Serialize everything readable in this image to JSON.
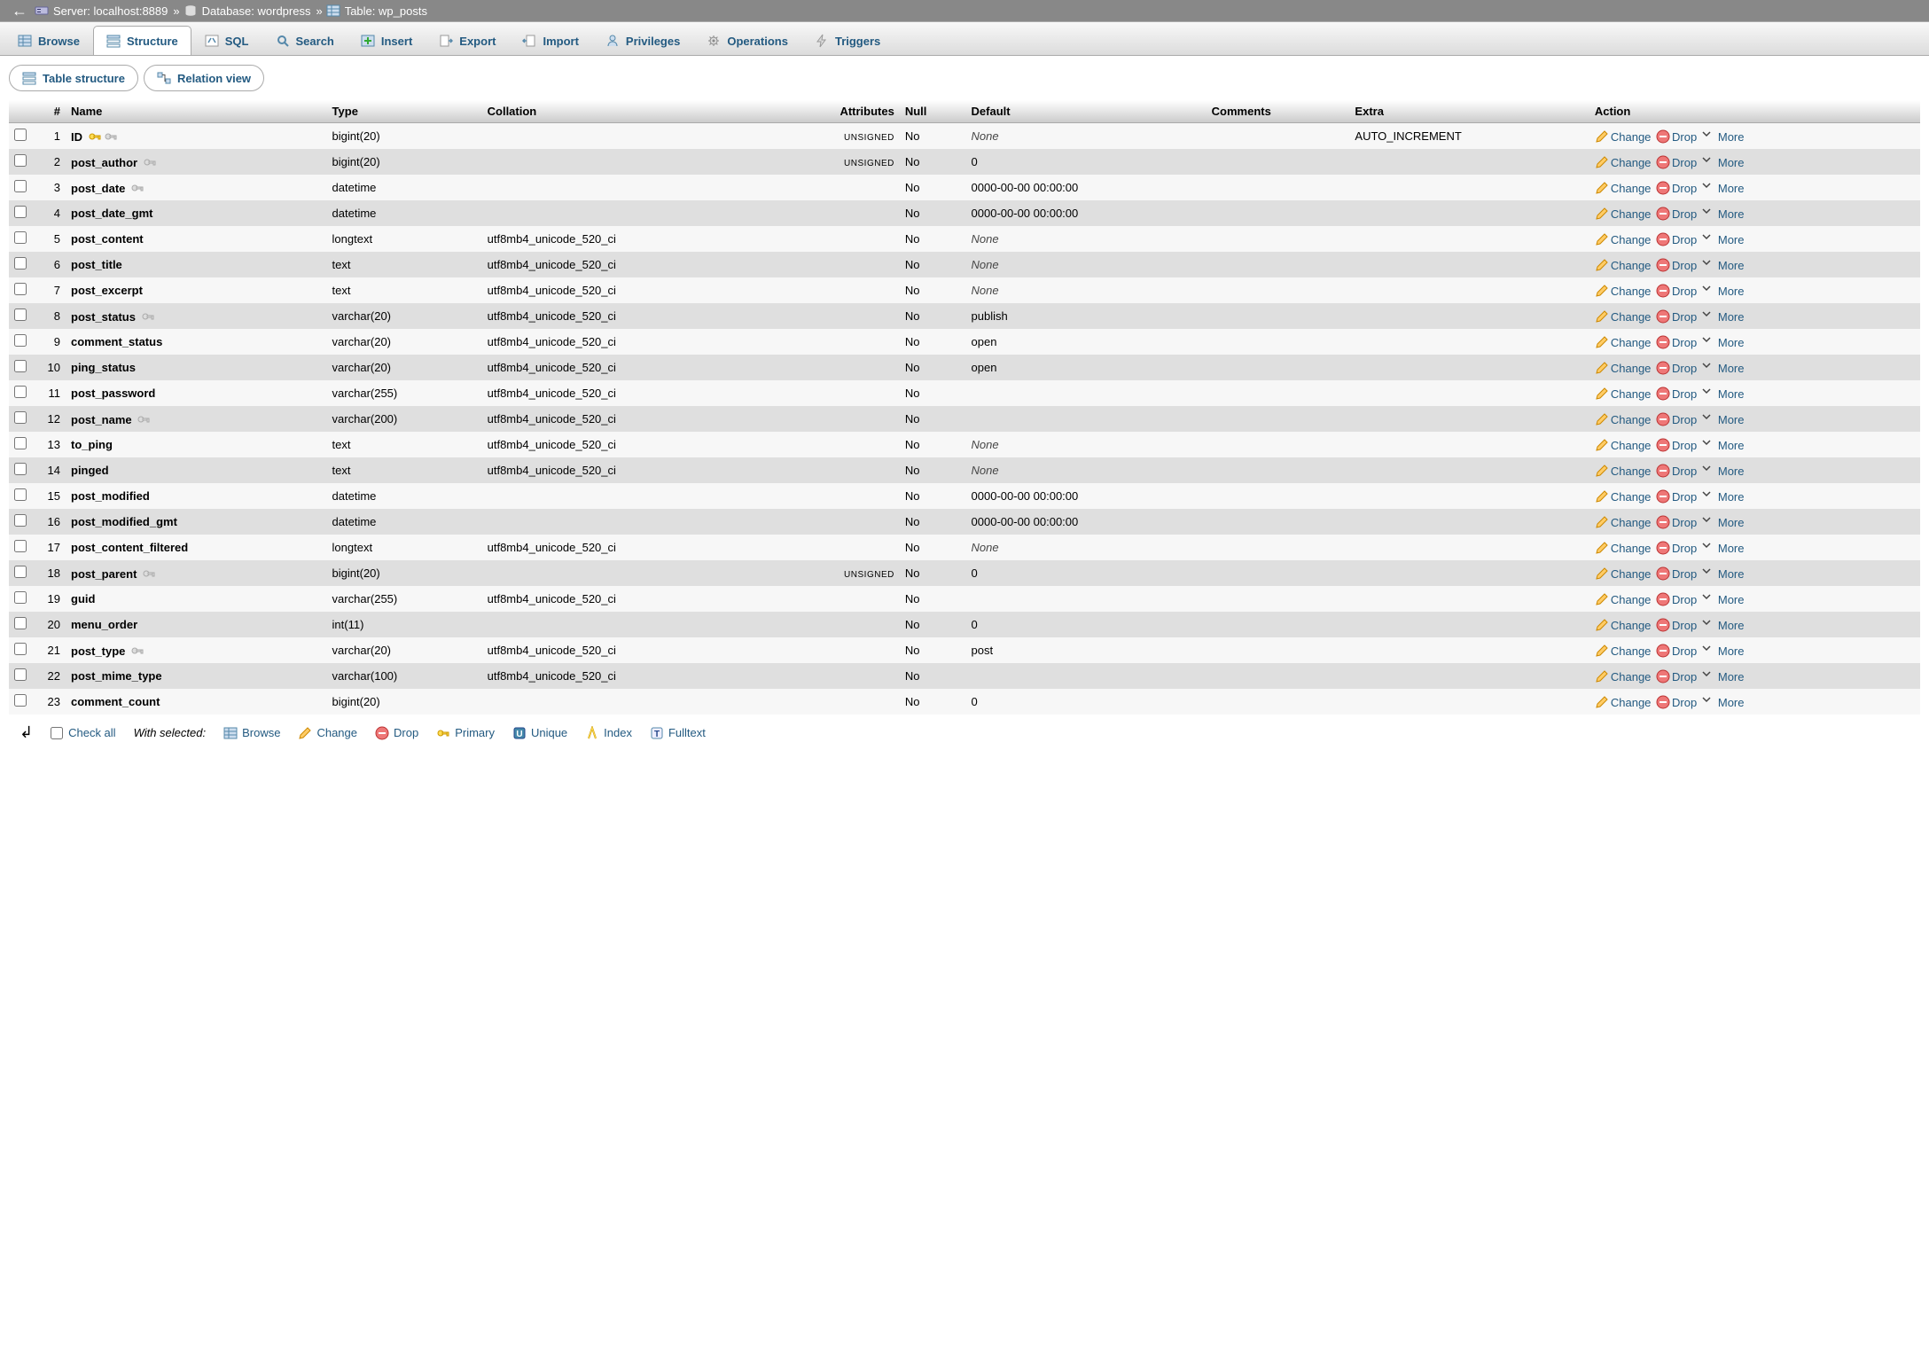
{
  "breadcrumb": {
    "server_label": "Server:",
    "server": "localhost:8889",
    "db_label": "Database:",
    "db": "wordpress",
    "table_label": "Table:",
    "table": "wp_posts"
  },
  "tabs": [
    {
      "label": "Browse",
      "icon": "table"
    },
    {
      "label": "Structure",
      "icon": "structure",
      "active": true
    },
    {
      "label": "SQL",
      "icon": "sql"
    },
    {
      "label": "Search",
      "icon": "search"
    },
    {
      "label": "Insert",
      "icon": "insert"
    },
    {
      "label": "Export",
      "icon": "export"
    },
    {
      "label": "Import",
      "icon": "import"
    },
    {
      "label": "Privileges",
      "icon": "privileges"
    },
    {
      "label": "Operations",
      "icon": "operations"
    },
    {
      "label": "Triggers",
      "icon": "triggers"
    }
  ],
  "subtabs": {
    "table_structure": "Table structure",
    "relation_view": "Relation view"
  },
  "headers": {
    "num": "#",
    "name": "Name",
    "type": "Type",
    "collation": "Collation",
    "attributes": "Attributes",
    "null": "Null",
    "default": "Default",
    "comments": "Comments",
    "extra": "Extra",
    "action": "Action"
  },
  "actions": {
    "change": "Change",
    "drop": "Drop",
    "more": "More"
  },
  "columns": [
    {
      "n": 1,
      "name": "ID",
      "type": "bigint(20)",
      "collation": "",
      "attributes": "UNSIGNED",
      "null": "No",
      "def": "None",
      "def_italic": true,
      "comments": "",
      "extra": "AUTO_INCREMENT",
      "pk": true,
      "idx": true
    },
    {
      "n": 2,
      "name": "post_author",
      "type": "bigint(20)",
      "collation": "",
      "attributes": "UNSIGNED",
      "null": "No",
      "def": "0",
      "comments": "",
      "extra": "",
      "idx": true
    },
    {
      "n": 3,
      "name": "post_date",
      "type": "datetime",
      "collation": "",
      "attributes": "",
      "null": "No",
      "def": "0000-00-00 00:00:00",
      "comments": "",
      "extra": "",
      "idx": true
    },
    {
      "n": 4,
      "name": "post_date_gmt",
      "type": "datetime",
      "collation": "",
      "attributes": "",
      "null": "No",
      "def": "0000-00-00 00:00:00",
      "comments": "",
      "extra": ""
    },
    {
      "n": 5,
      "name": "post_content",
      "type": "longtext",
      "collation": "utf8mb4_unicode_520_ci",
      "attributes": "",
      "null": "No",
      "def": "None",
      "def_italic": true,
      "comments": "",
      "extra": ""
    },
    {
      "n": 6,
      "name": "post_title",
      "type": "text",
      "collation": "utf8mb4_unicode_520_ci",
      "attributes": "",
      "null": "No",
      "def": "None",
      "def_italic": true,
      "comments": "",
      "extra": ""
    },
    {
      "n": 7,
      "name": "post_excerpt",
      "type": "text",
      "collation": "utf8mb4_unicode_520_ci",
      "attributes": "",
      "null": "No",
      "def": "None",
      "def_italic": true,
      "comments": "",
      "extra": ""
    },
    {
      "n": 8,
      "name": "post_status",
      "type": "varchar(20)",
      "collation": "utf8mb4_unicode_520_ci",
      "attributes": "",
      "null": "No",
      "def": "publish",
      "comments": "",
      "extra": "",
      "idx": true
    },
    {
      "n": 9,
      "name": "comment_status",
      "type": "varchar(20)",
      "collation": "utf8mb4_unicode_520_ci",
      "attributes": "",
      "null": "No",
      "def": "open",
      "comments": "",
      "extra": ""
    },
    {
      "n": 10,
      "name": "ping_status",
      "type": "varchar(20)",
      "collation": "utf8mb4_unicode_520_ci",
      "attributes": "",
      "null": "No",
      "def": "open",
      "comments": "",
      "extra": ""
    },
    {
      "n": 11,
      "name": "post_password",
      "type": "varchar(255)",
      "collation": "utf8mb4_unicode_520_ci",
      "attributes": "",
      "null": "No",
      "def": "",
      "comments": "",
      "extra": ""
    },
    {
      "n": 12,
      "name": "post_name",
      "type": "varchar(200)",
      "collation": "utf8mb4_unicode_520_ci",
      "attributes": "",
      "null": "No",
      "def": "",
      "comments": "",
      "extra": "",
      "idx": true
    },
    {
      "n": 13,
      "name": "to_ping",
      "type": "text",
      "collation": "utf8mb4_unicode_520_ci",
      "attributes": "",
      "null": "No",
      "def": "None",
      "def_italic": true,
      "comments": "",
      "extra": ""
    },
    {
      "n": 14,
      "name": "pinged",
      "type": "text",
      "collation": "utf8mb4_unicode_520_ci",
      "attributes": "",
      "null": "No",
      "def": "None",
      "def_italic": true,
      "comments": "",
      "extra": ""
    },
    {
      "n": 15,
      "name": "post_modified",
      "type": "datetime",
      "collation": "",
      "attributes": "",
      "null": "No",
      "def": "0000-00-00 00:00:00",
      "comments": "",
      "extra": ""
    },
    {
      "n": 16,
      "name": "post_modified_gmt",
      "type": "datetime",
      "collation": "",
      "attributes": "",
      "null": "No",
      "def": "0000-00-00 00:00:00",
      "comments": "",
      "extra": ""
    },
    {
      "n": 17,
      "name": "post_content_filtered",
      "type": "longtext",
      "collation": "utf8mb4_unicode_520_ci",
      "attributes": "",
      "null": "No",
      "def": "None",
      "def_italic": true,
      "comments": "",
      "extra": ""
    },
    {
      "n": 18,
      "name": "post_parent",
      "type": "bigint(20)",
      "collation": "",
      "attributes": "UNSIGNED",
      "null": "No",
      "def": "0",
      "comments": "",
      "extra": "",
      "idx": true
    },
    {
      "n": 19,
      "name": "guid",
      "type": "varchar(255)",
      "collation": "utf8mb4_unicode_520_ci",
      "attributes": "",
      "null": "No",
      "def": "",
      "comments": "",
      "extra": ""
    },
    {
      "n": 20,
      "name": "menu_order",
      "type": "int(11)",
      "collation": "",
      "attributes": "",
      "null": "No",
      "def": "0",
      "comments": "",
      "extra": ""
    },
    {
      "n": 21,
      "name": "post_type",
      "type": "varchar(20)",
      "collation": "utf8mb4_unicode_520_ci",
      "attributes": "",
      "null": "No",
      "def": "post",
      "comments": "",
      "extra": "",
      "idx": true
    },
    {
      "n": 22,
      "name": "post_mime_type",
      "type": "varchar(100)",
      "collation": "utf8mb4_unicode_520_ci",
      "attributes": "",
      "null": "No",
      "def": "",
      "comments": "",
      "extra": ""
    },
    {
      "n": 23,
      "name": "comment_count",
      "type": "bigint(20)",
      "collation": "",
      "attributes": "",
      "null": "No",
      "def": "0",
      "comments": "",
      "extra": ""
    }
  ],
  "footer": {
    "check_all": "Check all",
    "with_selected": "With selected:",
    "browse": "Browse",
    "change": "Change",
    "drop": "Drop",
    "primary": "Primary",
    "unique": "Unique",
    "index": "Index",
    "fulltext": "Fulltext"
  }
}
